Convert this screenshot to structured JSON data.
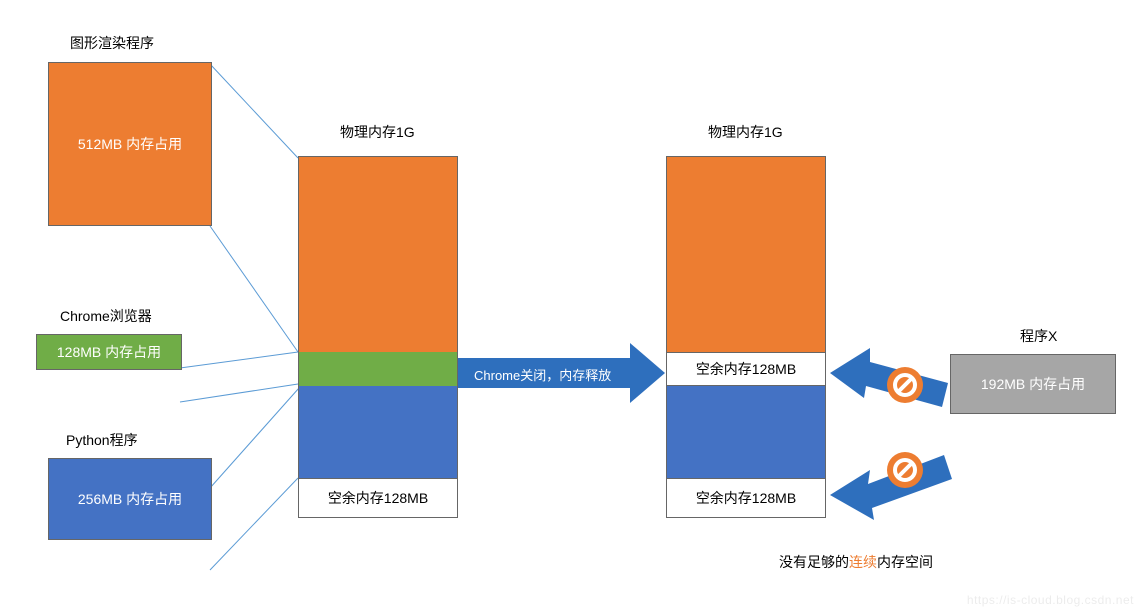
{
  "processes": {
    "graphics": {
      "title": "图形渲染程序",
      "text": "512MB 内存占用"
    },
    "chrome": {
      "title": "Chrome浏览器",
      "text": "128MB 内存占用"
    },
    "python": {
      "title": "Python程序",
      "text": "256MB 内存占用"
    },
    "x": {
      "title": "程序X",
      "text": "192MB 内存占用"
    }
  },
  "memory": {
    "left_title": "物理内存1G",
    "right_title": "物理内存1G",
    "free_128_a": "空余内存128MB",
    "free_128_b": "空余内存128MB",
    "free_128_c": "空余内存128MB"
  },
  "annotations": {
    "release": "Chrome关闭，内存释放",
    "not_enough_prefix": "没有足够的",
    "not_enough_highlight": "连续",
    "not_enough_suffix": "内存空间"
  },
  "watermark": "https://is-cloud.blog.csdn.net",
  "colors": {
    "orange": "#ED7D31",
    "green": "#70AD47",
    "blue": "#4472C4",
    "gray": "#A6A6A6",
    "arrow_blue": "#2E6FBD",
    "line_blue": "#5B9BD5"
  },
  "chart_data": {
    "type": "diagram",
    "title": "内存碎片示意图",
    "physical_memory_mb": 1024,
    "left_memory_layout": [
      {
        "name": "图形渲染程序",
        "size_mb": 512,
        "color": "orange"
      },
      {
        "name": "Chrome浏览器",
        "size_mb": 128,
        "color": "green"
      },
      {
        "name": "Python程序",
        "size_mb": 256,
        "color": "blue"
      },
      {
        "name": "空余",
        "size_mb": 128,
        "color": "white"
      }
    ],
    "right_memory_layout_after_chrome_close": [
      {
        "name": "图形渲染程序",
        "size_mb": 512,
        "color": "orange"
      },
      {
        "name": "空余",
        "size_mb": 128,
        "color": "white"
      },
      {
        "name": "Python程序",
        "size_mb": 256,
        "color": "blue"
      },
      {
        "name": "空余",
        "size_mb": 128,
        "color": "white"
      }
    ],
    "incoming_process": {
      "name": "程序X",
      "size_mb": 192
    },
    "can_allocate": false,
    "reason": "没有足够的连续内存空间"
  }
}
